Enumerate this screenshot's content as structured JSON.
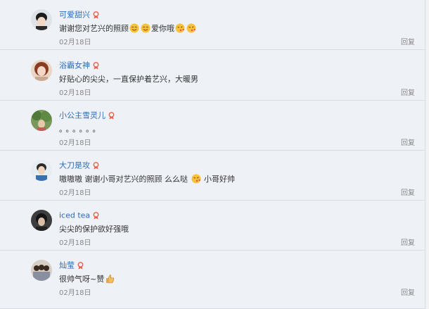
{
  "comments": [
    {
      "name": "可爱甜兴",
      "avatar": "avatar-boy-black-hair",
      "text_parts": [
        "谢谢您对艺兴的照顾",
        "爱你哦"
      ],
      "emojis_after_first": [
        "smile-emoji",
        "smile-emoji"
      ],
      "emojis_after_second": [
        "kiss-emoji",
        "kiss-emoji"
      ],
      "date": "02月18日",
      "reply": "回复"
    },
    {
      "name": "浴霸女神",
      "avatar": "avatar-girl-red-hair",
      "text": "好贴心的尖尖，一直保护着艺兴，大暖男",
      "date": "02月18日",
      "reply": "回复"
    },
    {
      "name": "小公主雪灵儿",
      "avatar": "avatar-outdoor-trees",
      "text": "。。。。。。",
      "date": "02月18日",
      "reply": "回复"
    },
    {
      "name": "大刀是攻",
      "avatar": "avatar-boy-blue-shirt",
      "text_parts": [
        "嗷嗷嗷 谢谢小哥对艺兴的照顾 么么哒",
        "小哥好帅"
      ],
      "emojis_after_first": [
        "kiss-emoji"
      ],
      "date": "02月18日",
      "reply": "回复"
    },
    {
      "name": "iced tea",
      "avatar": "avatar-dark-portrait",
      "text": "尖尖的保护欲好强哦",
      "date": "02月18日",
      "reply": "回复"
    },
    {
      "name": "灿莹",
      "avatar": "avatar-group-photo",
      "text": "很帅气呀~赞",
      "emojis_after_text": [
        "thumbs-up-emoji"
      ],
      "date": "02月18日",
      "reply": "回复"
    }
  ],
  "colors": {
    "name": "#2e6db4",
    "text": "#333333",
    "meta": "#888888",
    "badge": "#e8604c",
    "background": "#eef1f6"
  }
}
